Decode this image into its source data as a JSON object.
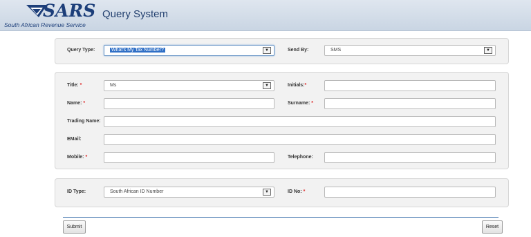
{
  "header": {
    "logo_text": "SARS",
    "logo_subtitle": "South African Revenue Service",
    "app_title": "Query System"
  },
  "query": {
    "query_type_label": "Query Type:",
    "query_type_value": "What's My Tax Number?",
    "send_by_label": "Send By:",
    "send_by_value": "SMS"
  },
  "personal": {
    "title_label": "Title:",
    "title_value": "Ms",
    "initials_label": "Initials:",
    "name_label": "Name:",
    "surname_label": "Surname:",
    "trading_name_label": "Trading Name:",
    "email_label": "EMail:",
    "mobile_label": "Mobile:",
    "telephone_label": "Telephone:",
    "required_marker": "*"
  },
  "identity": {
    "id_type_label": "ID Type:",
    "id_type_value": "South African ID Number",
    "id_no_label": "ID No:"
  },
  "actions": {
    "submit_label": "Submit",
    "reset_label": "Reset"
  },
  "dropdown_arrow_glyph": "▼",
  "colors": {
    "brand_blue": "#1d3f7a",
    "required_red": "#dd2222",
    "selection_blue": "#2f6fc6"
  }
}
